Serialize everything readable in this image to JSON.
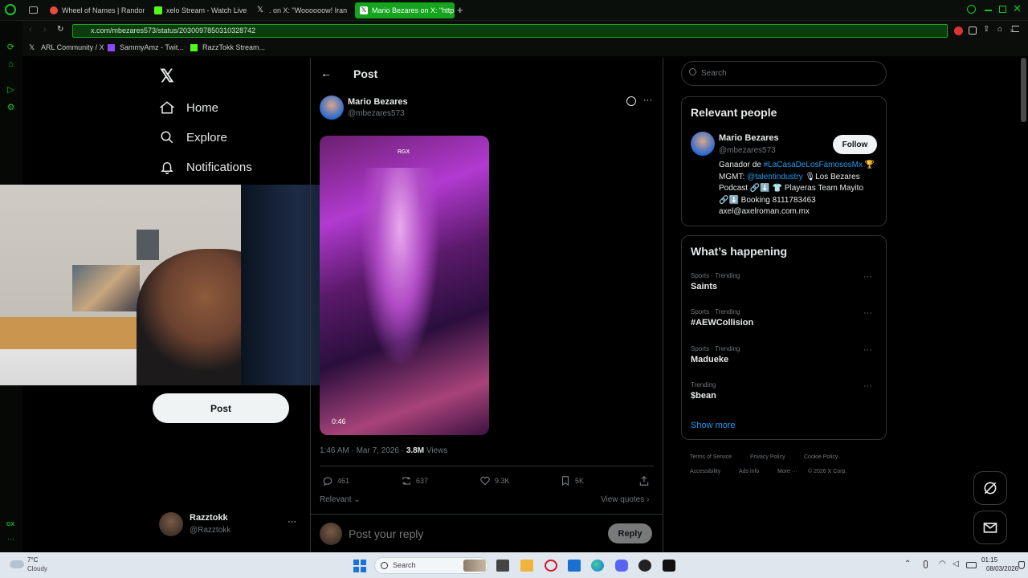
{
  "browser": {
    "tabs": [
      {
        "title": "Wheel of Names | Random",
        "fav_color": "#e94b3c"
      },
      {
        "title": "xelo Stream - Watch Live",
        "fav_color": "#53fc18"
      },
      {
        "title": ". on X: \"Woooooow! Iran",
        "fav_color": "#222222"
      },
      {
        "title": "Mario Bezares on X: \"http:",
        "fav_color": "#ffffff"
      }
    ],
    "url": "x.com/mbezares573/status/2030097850310328742",
    "bookmarks": [
      "ARL Community / X",
      "SammyAmz - Twit...",
      "RazzTokk Stream..."
    ],
    "gx_label": "GX"
  },
  "nav": {
    "home": "Home",
    "explore": "Explore",
    "notifications": "Notifications",
    "post_button": "Post",
    "account": {
      "name": "Razztokk",
      "handle": "@Razztokk"
    }
  },
  "post": {
    "header": "Post",
    "author": {
      "name": "Mario Bezares",
      "handle": "@mbezares573"
    },
    "video": {
      "duration": "0:46",
      "watermark": "RGX"
    },
    "time": "1:46 AM · Mar 7, 2026 · ",
    "views_count": "3.8M",
    "views_label": " Views",
    "stats": {
      "replies": "461",
      "reposts": "637",
      "likes": "9.3K",
      "bookmarks": "5K"
    },
    "sort": "Relevant",
    "view_quotes": "View quotes",
    "reply_placeholder": "Post your reply",
    "reply_button": "Reply"
  },
  "sidebar": {
    "search_placeholder": "Search",
    "relevant_title": "Relevant people",
    "person": {
      "name": "Mario Bezares",
      "handle": "@mbezares573",
      "follow": "Follow",
      "bio_1": "Ganador de ",
      "bio_tag": "#LaCasaDeLosFamososMx",
      "bio_2": "🏆 MGMT: ",
      "bio_mention": "@talentindustry",
      "bio_3": " 🎙Los Bezares Podcast 🔗⬇️ 👕 Playeras Team Mayito 🔗⬇️ Booking 8111783463 axel@axelroman.com.mx"
    },
    "happening_title": "What’s happening",
    "trends": [
      {
        "category": "Sports · Trending",
        "name": "Saints"
      },
      {
        "category": "Sports · Trending",
        "name": "#AEWCollision"
      },
      {
        "category": "Sports · Trending",
        "name": "Madueke"
      },
      {
        "category": "Trending",
        "name": "$bean"
      }
    ],
    "show_more": "Show more",
    "footer": [
      "Terms of Service",
      "Privacy Policy",
      "Cookie Policy",
      "Accessibility",
      "Ads info",
      "More ···",
      "© 2026 X Corp."
    ]
  },
  "taskbar": {
    "weather_temp": "7°C",
    "weather_desc": "Cloudy",
    "search": "Search",
    "time": "01:15",
    "date": "08/03/2026"
  }
}
